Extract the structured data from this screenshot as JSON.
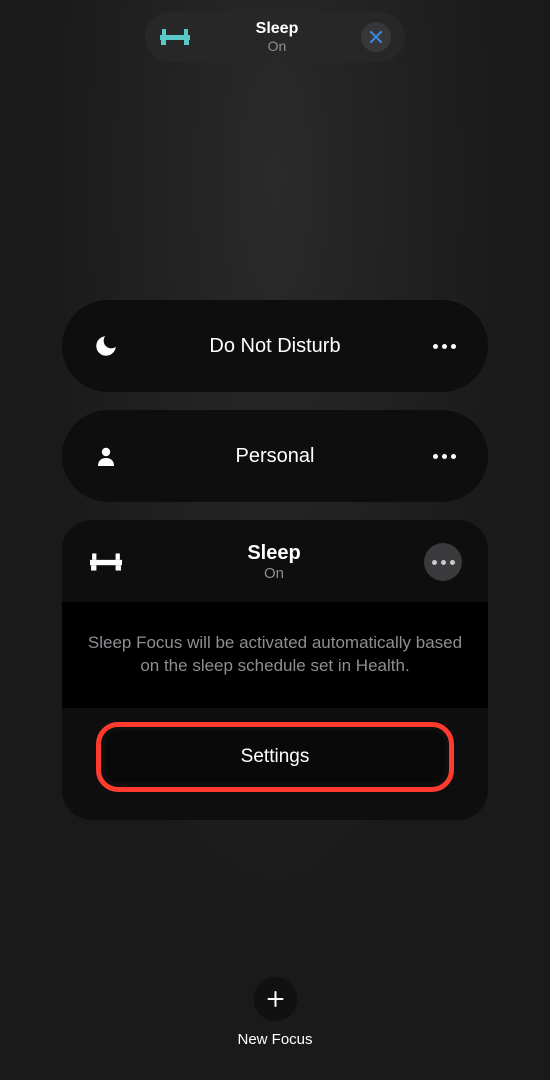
{
  "status_pill": {
    "title": "Sleep",
    "subtitle": "On"
  },
  "focus_modes": [
    {
      "label": "Do Not Disturb"
    },
    {
      "label": "Personal"
    }
  ],
  "sleep_card": {
    "title": "Sleep",
    "subtitle": "On",
    "description": "Sleep Focus will be activated automatically based on the sleep schedule set in Health.",
    "settings_label": "Settings"
  },
  "new_focus": {
    "label": "New Focus"
  },
  "colors": {
    "accent_highlight": "#ff3b30",
    "bed_icon": "#5ac8c8",
    "close_x": "#3a87d6"
  }
}
